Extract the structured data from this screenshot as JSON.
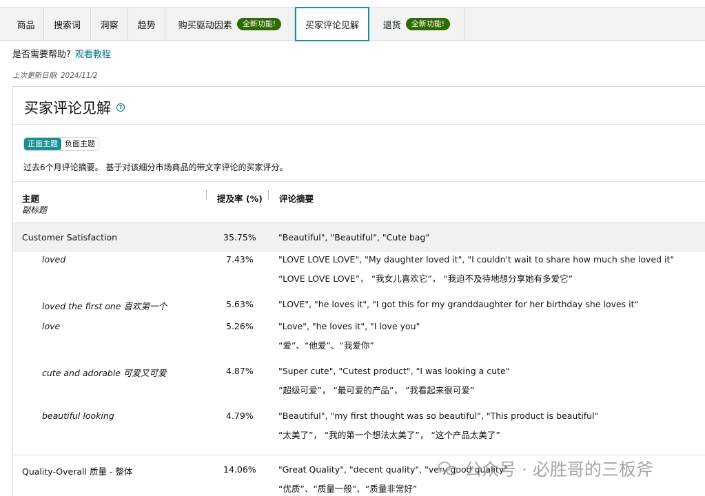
{
  "tabs": [
    {
      "label": "商品",
      "badge": ""
    },
    {
      "label": "搜索词",
      "badge": ""
    },
    {
      "label": "洞察",
      "badge": ""
    },
    {
      "label": "趋势",
      "badge": ""
    },
    {
      "label": "购买驱动因素",
      "badge": "全新功能!"
    },
    {
      "label": "买家评论见解",
      "badge": "",
      "active": true
    },
    {
      "label": "退货",
      "badge": "全新功能!"
    }
  ],
  "help": {
    "text": "是否需要帮助?",
    "link": "观看教程"
  },
  "updated": "上次更新日期: 2024/11/2",
  "panel": {
    "title": "买家评论见解",
    "toggle": {
      "positive": "正面主题",
      "negative": "负面主题"
    },
    "description": "过去6个月评论摘要。 基于对该细分市场商品的带文字评论的买家评分。"
  },
  "table": {
    "headers": {
      "topic": "主题",
      "subtitle": "副标题",
      "rate": "提及率 (%)",
      "summary": "评论摘要"
    },
    "rows": [
      {
        "topic": "Customer Satisfaction",
        "rate": "35.75%",
        "summary": [
          "\"Beautiful\", \"Beautiful\", \"Cute bag\""
        ],
        "group": true
      },
      {
        "topic": "loved",
        "rate": "7.43%",
        "summary": [
          "\"LOVE LOVE LOVE\", \"My daughter loved it\", \"I couldn't wait to share how much she loved it\"",
          "“LOVE LOVE LOVE”， “我女儿喜欢它”， “我迫不及待地想分享她有多爱它”"
        ]
      },
      {
        "topic": "loved the first one 喜欢第一个",
        "rate": "5.63%",
        "summary": [
          "\"LOVE\", \"he loves it\", \"I got this for my granddaughter for her birthday she loves it\""
        ]
      },
      {
        "topic": "love",
        "rate": "5.26%",
        "summary": [
          "\"Love\", \"he loves it\", \"I love you\"",
          "“爱”、“他爱”、“我爱你”"
        ]
      },
      {
        "topic": "cute and adorable 可爱又可爱",
        "rate": "4.87%",
        "summary": [
          "\"Super cute\", \"Cutest product\", \"I was looking a cute\"",
          "“超级可爱”， “最可爱的产品”， “我看起来很可爱”"
        ]
      },
      {
        "topic": "beautiful looking",
        "rate": "4.79%",
        "summary": [
          "\"Beautiful\", \"my first thought was so beautiful\", \"This product is beautiful\"",
          "“太美了”， “我的第一个想法太美了”， “这个产品太美了”"
        ]
      },
      {
        "topic": "Quality-Overall 质量 - 整体",
        "rate": "14.06%",
        "summary": [
          "\"Great Quality\", \"decent quality\", \"very good quality\"",
          "“优质”、“质量一般”、“质量非常好”"
        ]
      }
    ]
  },
  "watermark": "公众号 · 必胜哥的三板斧"
}
